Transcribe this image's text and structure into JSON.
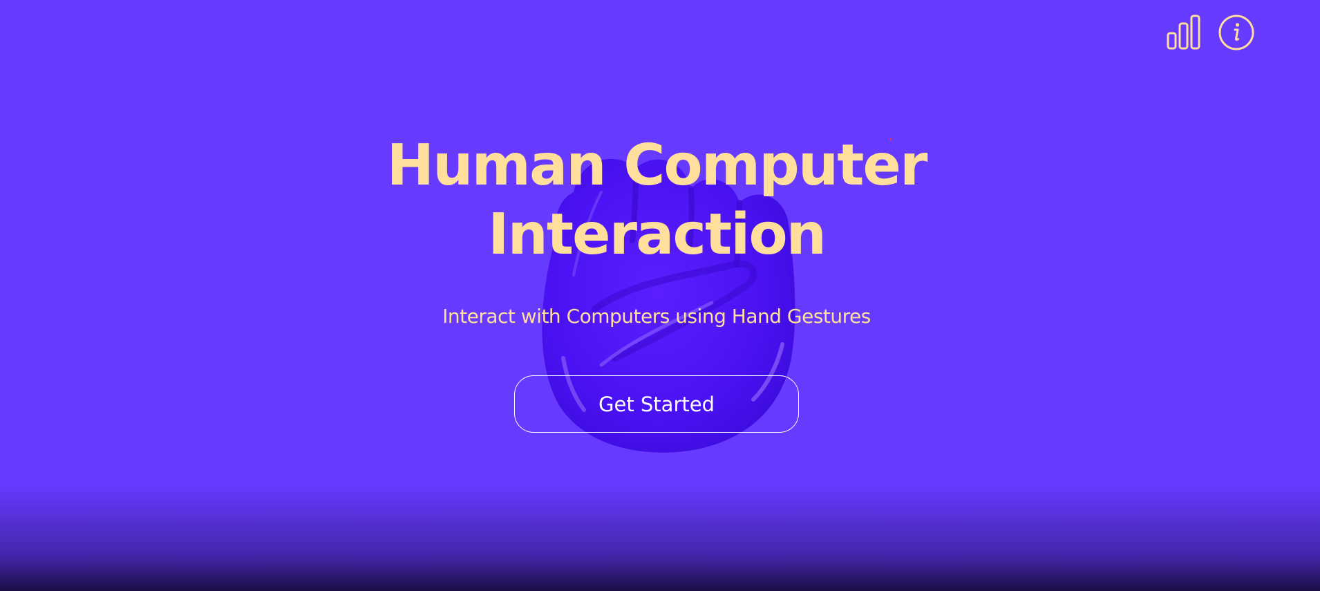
{
  "hero": {
    "title_line1": "Human Computer",
    "title_line2": "Interaction",
    "subtitle": "Interact with Computers using Hand Gestures",
    "cta_label": "Get Started"
  },
  "header": {
    "icons": [
      "bar-chart-icon",
      "info-icon"
    ]
  },
  "colors": {
    "background": "#673AFF",
    "accent_text": "#FFDF9B",
    "button_text": "#FFFFFF",
    "hand": "#5A1FFF"
  }
}
